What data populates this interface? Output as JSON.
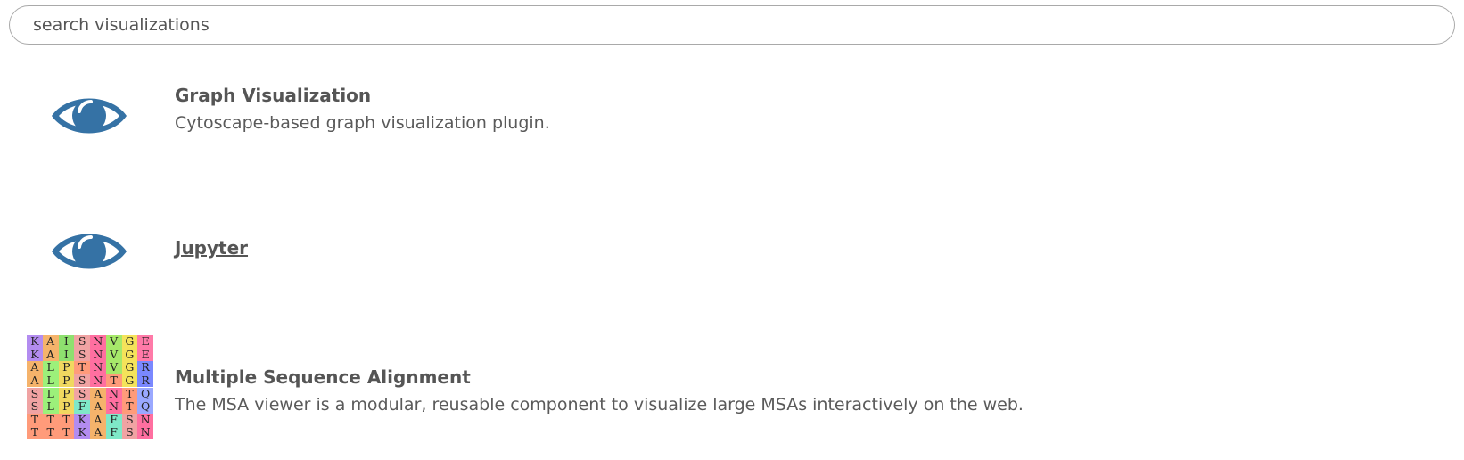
{
  "search": {
    "placeholder": "search visualizations",
    "value": ""
  },
  "items": [
    {
      "title": "Graph Visualization",
      "description": "Cytoscape-based graph visualization plugin.",
      "icon": "eye-icon",
      "icon_color": "#3572a5"
    },
    {
      "title": "Jupyter",
      "description": "",
      "icon": "eye-icon",
      "icon_color": "#3572a5"
    },
    {
      "title": "Multiple Sequence Alignment",
      "description": "The MSA viewer is a modular, reusable component to visualize large MSAs interactively on the web.",
      "icon": "msa-alignment-thumbnail",
      "msa_rows": [
        "KAISNVGE",
        "KAISNVGE",
        "ALPTNVGR",
        "ALPSNTGR",
        "SLPSANTQ",
        "SLPFANTQ",
        "TTTKAFSN",
        "TTTKAFSN"
      ],
      "residue_colors": {
        "K": "#b38cf0",
        "A": "#f5b36b",
        "I": "#8ee06f",
        "S": "#f0a3a3",
        "N": "#ff6fa0",
        "V": "#a6e86a",
        "G": "#f4e35a",
        "E": "#ff7aa8",
        "L": "#9cf07a",
        "P": "#f0d860",
        "T": "#ff9b7a",
        "R": "#7a88ff",
        "Q": "#9aa8ff",
        "F": "#7fe8c8"
      }
    }
  ]
}
